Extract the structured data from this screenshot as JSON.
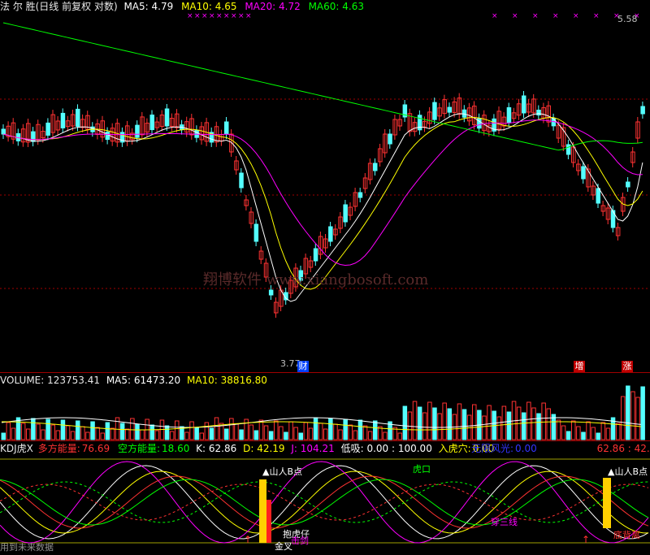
{
  "stock_header": {
    "title": "法 尔 胜(日线 前复权 对数)",
    "ma5": "MA5: 4.79",
    "ma10": "MA10: 4.65",
    "ma20": "MA20: 4.72",
    "ma60": "MA60: 4.63"
  },
  "price_panel": {
    "high_label": "5.58",
    "low_label": "3.77",
    "badge_cai": "财",
    "badge_zeng": "增",
    "badge_zhang": "涨",
    "watermark": "翔博软件 www.xiangbosoft.com"
  },
  "volume_header": {
    "volume": "VOLUME: 123753.41",
    "ma5": "MA5: 61473.20",
    "ma10": "MA10: 38816.80"
  },
  "kdj_header": {
    "name": "KDJ虎X",
    "bull_label": "多方能量:",
    "bull_value": "76.69",
    "bear_label": "空方能量:",
    "bear_value": "18.60",
    "k": "K: 62.86",
    "d": "D: 42.19",
    "j": "J: 104.21",
    "low_absorb": "低吸: 0.00 : 100.00",
    "tiger_label": "入虎穴:",
    "tiger_value": "0.00",
    "wind_label": "无限风光:",
    "wind_value": "0.00",
    "right_values": "62.86 : 42.19"
  },
  "indicator_annotations": {
    "shanren_b_1": "▲山人B点",
    "shanren_b_2": "▲山人B点",
    "hukou": "虎口",
    "baohuzi": "抱虎仔",
    "jincha": "金叉",
    "jishuai": "击剑",
    "chuansanxian": "穿三线",
    "dibeili": "底背离",
    "footer": "用到未来数据"
  },
  "colors": {
    "ma5": "#ffffff",
    "ma10": "#ffff00",
    "ma20": "#ff00ff",
    "ma60": "#00ff00",
    "up": "#ff3232",
    "down": "#54ffff",
    "grid": "#a00000"
  },
  "chart_data": [
    {
      "type": "candlestick",
      "title": "法 尔 胜(日线 前复权 对数)",
      "series": [
        {
          "name": "MA5",
          "values": [
            4.79
          ]
        },
        {
          "name": "MA10",
          "values": [
            4.65
          ]
        },
        {
          "name": "MA20",
          "values": [
            4.72
          ]
        },
        {
          "name": "MA60",
          "values": [
            4.63
          ]
        }
      ],
      "annotations": [
        "5.58",
        "3.77"
      ]
    },
    {
      "type": "bar",
      "title": "VOLUME",
      "series": [
        {
          "name": "VOLUME",
          "values": [
            123753.41
          ]
        },
        {
          "name": "MA5",
          "values": [
            61473.2
          ]
        },
        {
          "name": "MA10",
          "values": [
            38816.8
          ]
        }
      ]
    },
    {
      "type": "line",
      "title": "KDJ虎X",
      "series": [
        {
          "name": "K",
          "values": [
            62.86
          ]
        },
        {
          "name": "D",
          "values": [
            42.19
          ]
        },
        {
          "name": "J",
          "values": [
            104.21
          ]
        }
      ]
    }
  ]
}
